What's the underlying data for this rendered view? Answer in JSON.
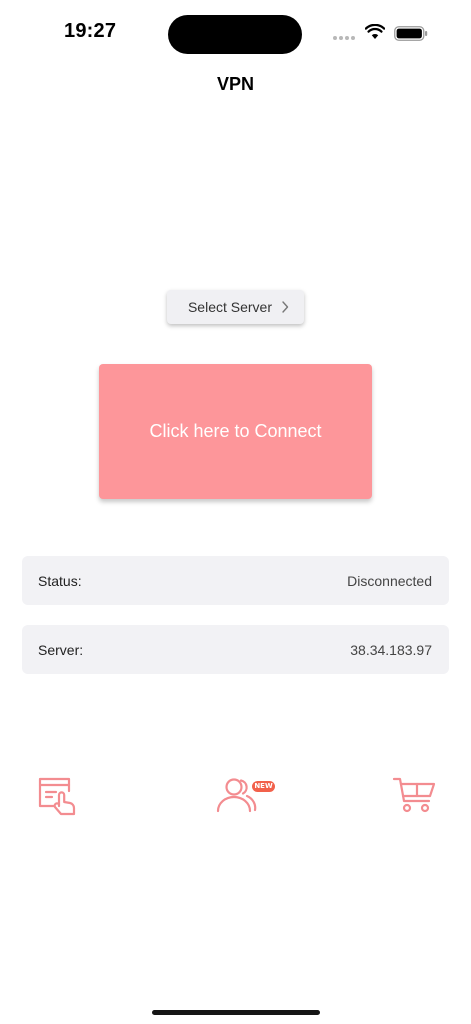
{
  "status_bar": {
    "time": "19:27"
  },
  "header": {
    "title": "VPN"
  },
  "server_selector": {
    "label": "Select Server",
    "icon": "chevron-right-icon"
  },
  "connect": {
    "label": "Click here to Connect",
    "color": "#fd969a"
  },
  "info": {
    "status_label": "Status:",
    "status_value": "Disconnected",
    "server_label": "Server:",
    "server_value": "38.34.183.97"
  },
  "bottom_bar": {
    "accent": "#f38c90",
    "items": [
      {
        "icon": "tap-screen-icon"
      },
      {
        "icon": "users-icon",
        "badge": "NEW"
      },
      {
        "icon": "cart-icon"
      }
    ]
  }
}
